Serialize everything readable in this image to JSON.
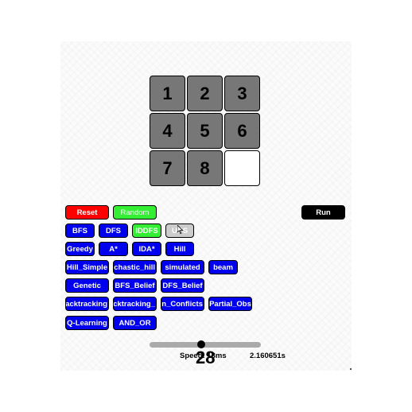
{
  "board": {
    "tiles": [
      "1",
      "2",
      "3",
      "4",
      "5",
      "6",
      "7",
      "8",
      ""
    ]
  },
  "controls": {
    "reset": "Reset",
    "random": "Random",
    "run": "Run"
  },
  "algorithms": {
    "bfs": "BFS",
    "dfs": "DFS",
    "iddfs": "IDDFS",
    "ucs": "UCS",
    "greedy": "Greedy",
    "astar": "A*",
    "idastar": "IDA*",
    "hill": "Hill",
    "hill_simple": "Hill_Simple",
    "stochastic_hill": "Stochastic_hill",
    "simulated": "simulated",
    "beam": "beam",
    "genetic": "Genetic",
    "bfs_belief": "BFS_Belief",
    "dfs_belief": "DFS_Belief",
    "backtracking": "Backtracking",
    "backtracking_fc": "Backtracking_",
    "min_conflicts": "Min_Conflicts",
    "partial_obs": "Partial_Obs",
    "q_learning": "Q-Learning",
    "and_or": "AND_OR"
  },
  "status": {
    "speed_label": "Speed: 13ms",
    "step_count": "28",
    "elapsed_time": "2.160651s"
  },
  "colors": {
    "tile": "#777777",
    "blank_tile": "#ffffff",
    "algorithm_button": "#0000ee",
    "reset_button": "#ff0000",
    "active_button": "#33ee33",
    "hover_button": "#cccccc",
    "run_button": "#000000",
    "slider_track": "#aaaaaa"
  },
  "icons": {
    "cursor": "mouse-pointer-icon"
  }
}
